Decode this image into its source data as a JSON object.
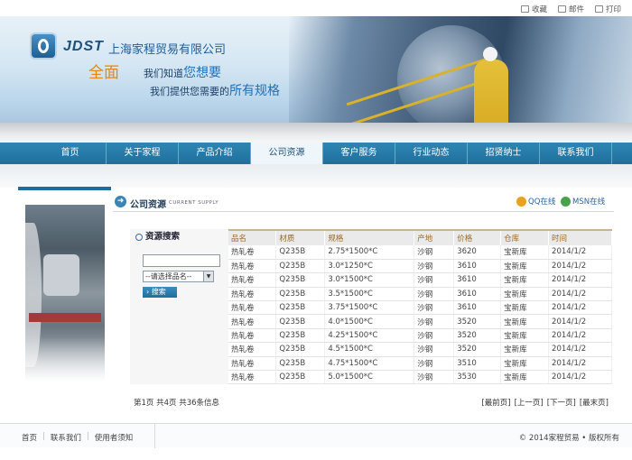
{
  "toolbar": {
    "bookmark": "收藏",
    "mail": "邮件",
    "print": "打印"
  },
  "brand": {
    "logo_text": "JDST",
    "company": "上海家程贸易有限公司",
    "slogan_big": "全面",
    "slogan_line1_pre": "我们知道",
    "slogan_line1_hl": "您想要",
    "slogan_line2_pre": "我们提供您需要的",
    "slogan_line2_hl": "所有规格"
  },
  "nav": [
    "首页",
    "关于家程",
    "产品介绍",
    "公司资源",
    "客户服务",
    "行业动态",
    "招贤纳士",
    "联系我们"
  ],
  "section": {
    "title": "公司资源",
    "subtitle": "CURRENT SUPPLY",
    "qq": "QQ在线",
    "msn": "MSN在线"
  },
  "search": {
    "title": "资源搜索",
    "input_value": "",
    "select_value": "--请选择品名--",
    "button": "搜索"
  },
  "table": {
    "headers": [
      "品名",
      "材质",
      "规格",
      "产地",
      "价格",
      "仓库",
      "时间"
    ],
    "rows": [
      [
        "热轧卷",
        "Q235B",
        "2.75*1500*C",
        "沙钢",
        "3620",
        "宝新库",
        "2014/1/2"
      ],
      [
        "热轧卷",
        "Q235B",
        "3.0*1250*C",
        "沙钢",
        "3610",
        "宝新库",
        "2014/1/2"
      ],
      [
        "热轧卷",
        "Q235B",
        "3.0*1500*C",
        "沙钢",
        "3610",
        "宝新库",
        "2014/1/2"
      ],
      [
        "热轧卷",
        "Q235B",
        "3.5*1500*C",
        "沙钢",
        "3610",
        "宝新库",
        "2014/1/2"
      ],
      [
        "热轧卷",
        "Q235B",
        "3.75*1500*C",
        "沙钢",
        "3610",
        "宝新库",
        "2014/1/2"
      ],
      [
        "热轧卷",
        "Q235B",
        "4.0*1500*C",
        "沙钢",
        "3520",
        "宝新库",
        "2014/1/2"
      ],
      [
        "热轧卷",
        "Q235B",
        "4.25*1500*C",
        "沙钢",
        "3520",
        "宝新库",
        "2014/1/2"
      ],
      [
        "热轧卷",
        "Q235B",
        "4.5*1500*C",
        "沙钢",
        "3520",
        "宝新库",
        "2014/1/2"
      ],
      [
        "热轧卷",
        "Q235B",
        "4.75*1500*C",
        "沙钢",
        "3510",
        "宝新库",
        "2014/1/2"
      ],
      [
        "热轧卷",
        "Q235B",
        "5.0*1500*C",
        "沙钢",
        "3530",
        "宝新库",
        "2014/1/2"
      ]
    ]
  },
  "pager": {
    "info": "第1页 共4页 共36条信息",
    "first": "[最前页]",
    "prev": "[上一页]",
    "next": "[下一页]",
    "last": "[最末页]"
  },
  "footer": {
    "home": "首页",
    "contact": "联系我们",
    "terms": "使用者须知",
    "copyright": "© 2014家程贸易 • 版权所有"
  },
  "colors": {
    "nav": "#1f6f9d",
    "accent_orange": "#e98512",
    "header_text": "#9a6a25"
  }
}
